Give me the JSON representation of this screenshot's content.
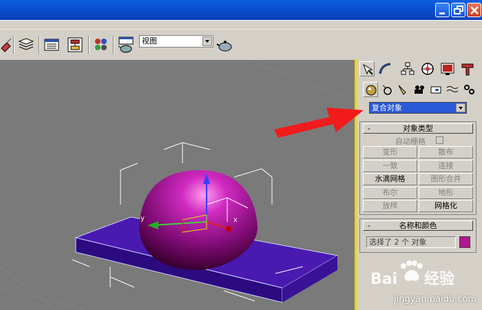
{
  "viewport_selector": {
    "value": "视图"
  },
  "command_panel": {
    "category_dropdown": {
      "value": "复合对象"
    },
    "object_type": {
      "title": "对象类型",
      "collapse": "-",
      "autogrid_label": "自动栅格",
      "buttons": [
        {
          "label": "变形",
          "enabled": false
        },
        {
          "label": "散布",
          "enabled": false
        },
        {
          "label": "一致",
          "enabled": false
        },
        {
          "label": "连接",
          "enabled": false
        },
        {
          "label": "水滴网格",
          "enabled": true
        },
        {
          "label": "图形合并",
          "enabled": false
        },
        {
          "label": "布尔",
          "enabled": false
        },
        {
          "label": "地形",
          "enabled": false
        },
        {
          "label": "放样",
          "enabled": false
        },
        {
          "label": "网格化",
          "enabled": true
        }
      ]
    },
    "name_color": {
      "title": "名称和颜色",
      "collapse": "-",
      "name_value": "选择了 2 个 对象",
      "color": "#b01890"
    }
  },
  "scene": {
    "axis_x": "x",
    "axis_y": "y"
  },
  "watermark": {
    "url": "jingyan.baidu.com"
  }
}
